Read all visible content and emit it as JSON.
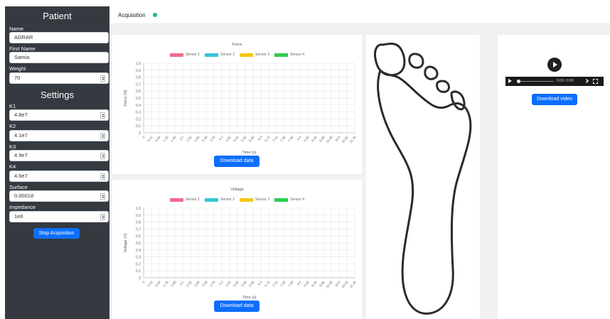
{
  "sidebar": {
    "patient_heading": "Patient",
    "settings_heading": "Settings",
    "name": {
      "label": "Name",
      "value": "ADRAR"
    },
    "first_name": {
      "label": "First Name",
      "value": "Samia"
    },
    "weight": {
      "label": "Weight",
      "value": "70"
    },
    "k1": {
      "label": "K1",
      "value": "4.8e7"
    },
    "k2": {
      "label": "K2",
      "value": "4.1e7"
    },
    "k3": {
      "label": "K3",
      "value": "4.9e7"
    },
    "k4": {
      "label": "K4",
      "value": "4.6e7"
    },
    "surface": {
      "label": "Surface",
      "value": "0.00018"
    },
    "impedance": {
      "label": "Impedance",
      "value": "1e6"
    },
    "stop_button": "Stop Acquisition"
  },
  "topbar": {
    "title": "Acquisition",
    "status_color": "#1eb980"
  },
  "download_data_label": "Download data",
  "video": {
    "time": "0:00 / 0:00",
    "download_label": "Download video"
  },
  "chart_data": [
    {
      "type": "line",
      "title": "Force",
      "xlabel": "Time (s)",
      "ylabel": "Force (N)",
      "ylim": [
        0,
        1
      ],
      "yticks": [
        "1,0",
        "0,9",
        "0,8",
        "0,7",
        "0,6",
        "0,5",
        "0,4",
        "0,3",
        "0,2",
        "0,1",
        "0"
      ],
      "categories": [
        "0",
        "0.42",
        "0.84",
        "1.26",
        "1.68",
        "2.1",
        "2.52",
        "2.94",
        "3.36",
        "3.78",
        "4.2",
        "4.62",
        "5.04",
        "5.46",
        "5.88",
        "6.3",
        "6.72",
        "7.14",
        "7.56",
        "7.98",
        "8.4",
        "8.82",
        "9.24",
        "9.66",
        "10.08",
        "10.5",
        "10.92",
        "11.34"
      ],
      "series": [
        {
          "name": "Sensor 1",
          "color": "#f06c8a",
          "values": []
        },
        {
          "name": "Sensor 2",
          "color": "#36c5d8",
          "values": []
        },
        {
          "name": "Sensor 3",
          "color": "#f5c518",
          "values": []
        },
        {
          "name": "Sensor 4",
          "color": "#2ecc50",
          "values": []
        }
      ],
      "grid": true,
      "legend": "top"
    },
    {
      "type": "line",
      "title": "Voltage",
      "xlabel": "Time (s)",
      "ylabel": "Voltage (V)",
      "ylim": [
        0,
        1
      ],
      "yticks": [
        "1,0",
        "0,9",
        "0,8",
        "0,7",
        "0,6",
        "0,5",
        "0,4",
        "0,3",
        "0,2",
        "0,1",
        "0"
      ],
      "categories": [
        "0",
        "0.42",
        "0.84",
        "1.26",
        "1.68",
        "2.1",
        "2.52",
        "2.94",
        "3.36",
        "3.78",
        "4.2",
        "4.62",
        "5.04",
        "5.46",
        "5.88",
        "6.3",
        "6.72",
        "7.14",
        "7.56",
        "7.98",
        "8.4",
        "8.82",
        "9.24",
        "9.66",
        "10.08",
        "10.5",
        "10.92",
        "11.34"
      ],
      "series": [
        {
          "name": "Sensor 1",
          "color": "#f06c8a",
          "values": []
        },
        {
          "name": "Sensor 2",
          "color": "#36c5d8",
          "values": []
        },
        {
          "name": "Sensor 3",
          "color": "#f5c518",
          "values": []
        },
        {
          "name": "Sensor 4",
          "color": "#2ecc50",
          "values": []
        }
      ],
      "grid": true,
      "legend": "top"
    }
  ]
}
